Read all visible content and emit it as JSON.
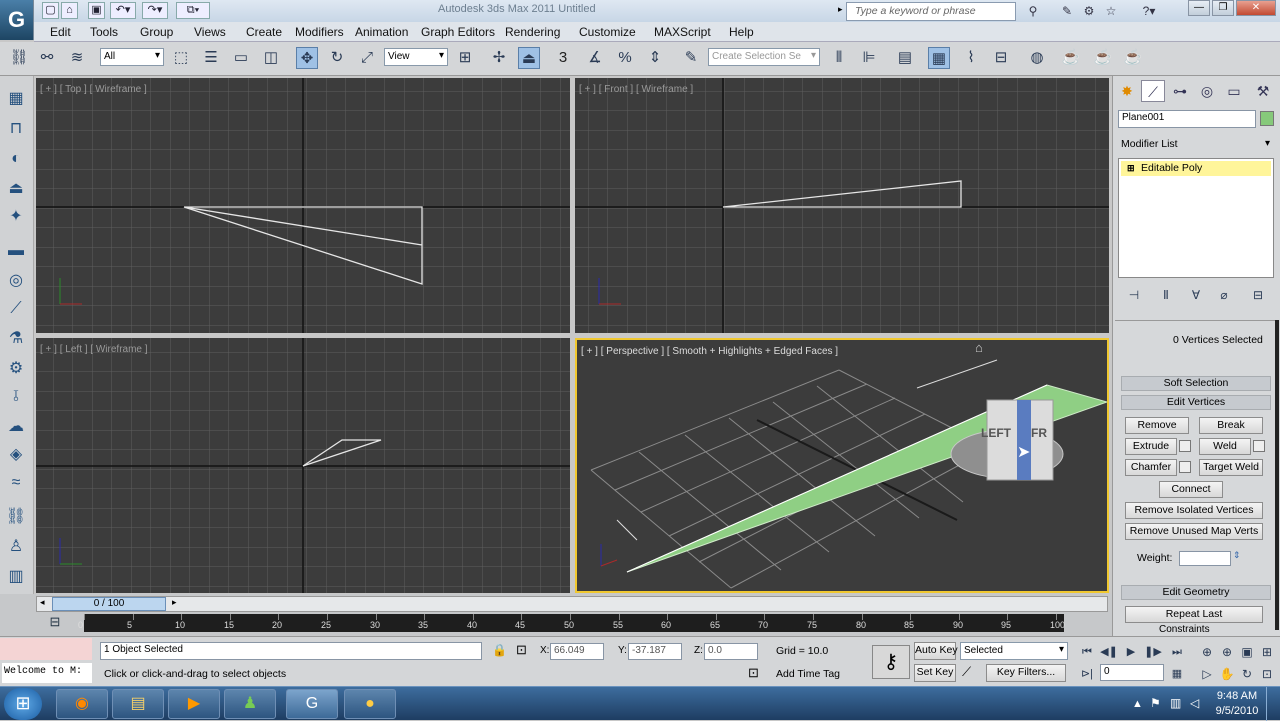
{
  "window": {
    "title": "Autodesk 3ds Max  2011        Untitled",
    "search_placeholder": "Type a keyword or phrase",
    "logo": "G"
  },
  "menu": [
    "Edit",
    "Tools",
    "Group",
    "Views",
    "Create",
    "Modifiers",
    "Animation",
    "Graph Editors",
    "Rendering",
    "Customize",
    "MAXScript",
    "Help"
  ],
  "toolbar": {
    "filter_value": "All",
    "refcoord_value": "View",
    "snap_label": "3",
    "selset_placeholder": "Create Selection Se"
  },
  "viewports": {
    "top_label": "[ + ] [ Top ] [ Wireframe ]",
    "front_label": "[ + ] [ Front ] [ Wireframe ]",
    "left_label": "[ + ] [ Left ] [ Wireframe ]",
    "persp_label": "[ + ] [ Perspective ] [ Smooth + Highlights + Edged Faces ]",
    "viewcube_left": "LEFT",
    "viewcube_front": "FR"
  },
  "panel": {
    "object_name": "Plane001",
    "object_color": "#86c97a",
    "modifier_list_label": "Modifier List",
    "stack_item": "Editable Poly",
    "vertices_selected": "0 Vertices Selected",
    "soft_selection": "Soft Selection",
    "edit_vertices": "Edit Vertices",
    "remove": "Remove",
    "break": "Break",
    "extrude": "Extrude",
    "weld": "Weld",
    "chamfer": "Chamfer",
    "target_weld": "Target Weld",
    "connect": "Connect",
    "remove_isolated": "Remove Isolated Vertices",
    "remove_unused": "Remove Unused Map Verts",
    "weight_label": "Weight:",
    "edit_geometry": "Edit Geometry",
    "repeat_last": "Repeat Last",
    "constraints": "Constraints"
  },
  "timeline": {
    "frame_display": "0 / 100",
    "ticks": [
      "0",
      "5",
      "10",
      "15",
      "20",
      "25",
      "30",
      "35",
      "40",
      "45",
      "50",
      "55",
      "60",
      "65",
      "70",
      "75",
      "80",
      "85",
      "90",
      "95",
      "100"
    ]
  },
  "status": {
    "maxscript": "Welcome to M:",
    "selection": "1 Object Selected",
    "prompt": "Click or click-and-drag to select objects",
    "x_label": "X:",
    "x_value": "66.049",
    "y_label": "Y:",
    "y_value": "-37.187",
    "z_label": "Z:",
    "z_value": "0.0",
    "grid": "Grid = 10.0",
    "add_time_tag": "Add Time Tag",
    "auto_key": "Auto Key",
    "set_key": "Set Key",
    "key_mode": "Selected",
    "key_filters": "Key Filters...",
    "frame": "0"
  },
  "taskbar": {
    "time": "9:48 AM",
    "date": "9/5/2010"
  }
}
